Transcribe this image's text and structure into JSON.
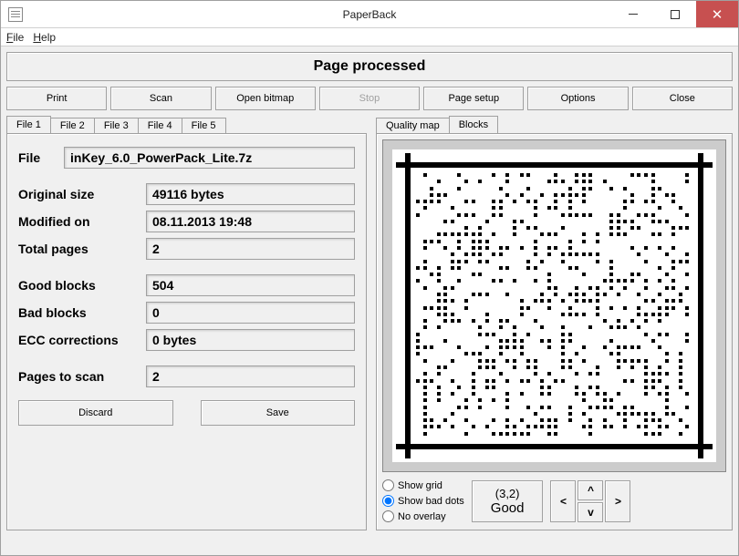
{
  "window": {
    "title": "PaperBack"
  },
  "menu": {
    "file": "File",
    "help": "Help"
  },
  "status_banner": "Page processed",
  "toolbar": {
    "print": "Print",
    "scan": "Scan",
    "open_bitmap": "Open bitmap",
    "stop": "Stop",
    "page_setup": "Page setup",
    "options": "Options",
    "close": "Close"
  },
  "left": {
    "tabs": [
      "File 1",
      "File 2",
      "File 3",
      "File 4",
      "File 5"
    ],
    "file_label": "File",
    "file_value": "inKey_6.0_PowerPack_Lite.7z",
    "fields": {
      "original_size": {
        "label": "Original size",
        "value": "49116 bytes"
      },
      "modified_on": {
        "label": "Modified on",
        "value": "08.11.2013 19:48"
      },
      "total_pages": {
        "label": "Total pages",
        "value": "2"
      },
      "good_blocks": {
        "label": "Good blocks",
        "value": "504"
      },
      "bad_blocks": {
        "label": "Bad blocks",
        "value": "0"
      },
      "ecc_corrections": {
        "label": "ECC corrections",
        "value": "0 bytes"
      },
      "pages_to_scan": {
        "label": "Pages to scan",
        "value": "2"
      }
    },
    "discard": "Discard",
    "save": "Save"
  },
  "right": {
    "tabs": {
      "quality": "Quality map",
      "blocks": "Blocks"
    },
    "radios": {
      "show_grid": "Show grid",
      "show_bad": "Show bad dots",
      "no_overlay": "No overlay"
    },
    "coord": "(3,2)",
    "coord_status": "Good",
    "nav": {
      "up": "^",
      "down": "v",
      "left": "<",
      "right": ">"
    }
  }
}
